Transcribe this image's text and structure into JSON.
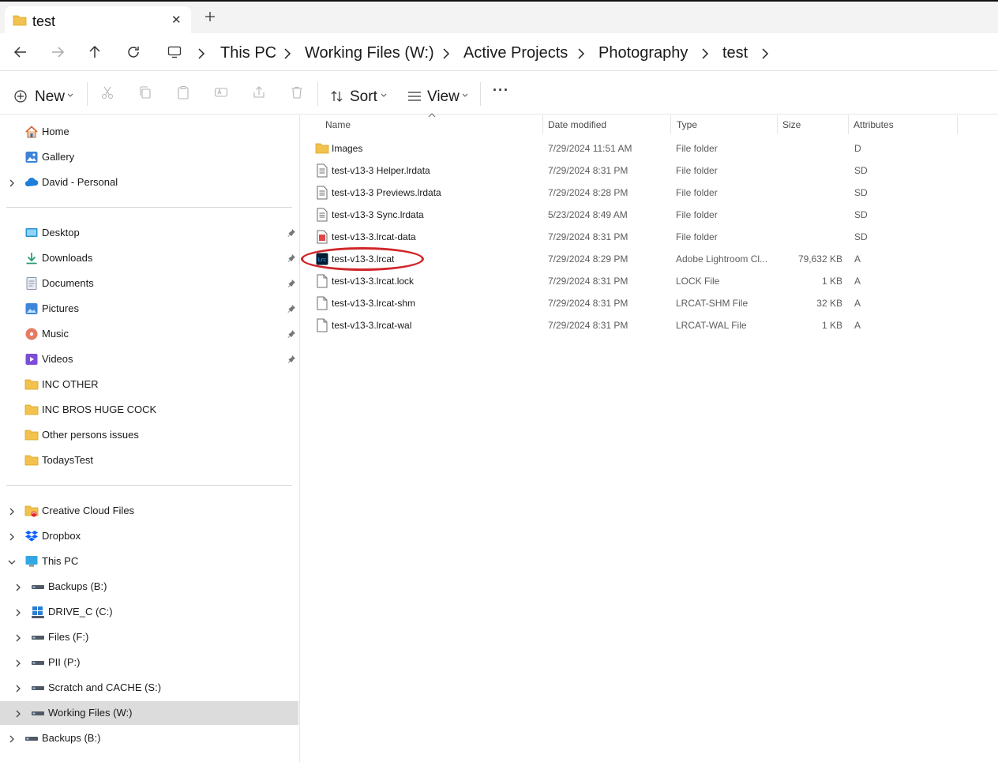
{
  "tab": {
    "title": "test",
    "close_glyph": "✕",
    "new_glyph": "+"
  },
  "breadcrumb": [
    "This PC",
    "Working Files (W:)",
    "Active Projects",
    "Photography",
    "test"
  ],
  "toolbar": {
    "new_label": "New",
    "sort_label": "Sort",
    "view_label": "View",
    "more_glyph": "···"
  },
  "sidebar": {
    "quick": [
      {
        "label": "Home",
        "icon": "home-icon",
        "expandable": false
      },
      {
        "label": "Gallery",
        "icon": "gallery-icon",
        "expandable": false
      },
      {
        "label": "David - Personal",
        "icon": "onedrive-icon",
        "expandable": true
      }
    ],
    "pinned": [
      {
        "label": "Desktop",
        "icon": "desktop-icon",
        "pinned": true
      },
      {
        "label": "Downloads",
        "icon": "downloads-icon",
        "pinned": true
      },
      {
        "label": "Documents",
        "icon": "documents-icon",
        "pinned": true
      },
      {
        "label": "Pictures",
        "icon": "pictures-icon",
        "pinned": true
      },
      {
        "label": "Music",
        "icon": "music-icon",
        "pinned": true
      },
      {
        "label": "Videos",
        "icon": "videos-icon",
        "pinned": true
      },
      {
        "label": "INC OTHER",
        "icon": "folder-icon",
        "pinned": false
      },
      {
        "label": "INC BROS HUGE COCK",
        "icon": "folder-icon",
        "pinned": false
      },
      {
        "label": "Other persons issues",
        "icon": "folder-icon",
        "pinned": false
      },
      {
        "label": "TodaysTest",
        "icon": "folder-icon",
        "pinned": false
      }
    ],
    "locations": [
      {
        "label": "Creative Cloud Files",
        "icon": "creative-cloud-icon",
        "level": 0,
        "expand": "collapsed"
      },
      {
        "label": "Dropbox",
        "icon": "dropbox-icon",
        "level": 0,
        "expand": "collapsed"
      },
      {
        "label": "This PC",
        "icon": "this-pc-icon",
        "level": 0,
        "expand": "expanded"
      },
      {
        "label": "Backups (B:)",
        "icon": "drive-icon",
        "level": 1,
        "expand": "collapsed"
      },
      {
        "label": "DRIVE_C (C:)",
        "icon": "windows-drive-icon",
        "level": 1,
        "expand": "collapsed"
      },
      {
        "label": "Files (F:)",
        "icon": "drive-icon",
        "level": 1,
        "expand": "collapsed"
      },
      {
        "label": "PII (P:)",
        "icon": "drive-icon",
        "level": 1,
        "expand": "collapsed"
      },
      {
        "label": "Scratch and CACHE (S:)",
        "icon": "drive-icon",
        "level": 1,
        "expand": "collapsed"
      },
      {
        "label": "Working Files (W:)",
        "icon": "drive-icon",
        "level": 1,
        "expand": "collapsed",
        "selected": true
      },
      {
        "label": "Backups (B:)",
        "icon": "drive-icon",
        "level": 0,
        "expand": "collapsed"
      }
    ]
  },
  "columns": {
    "name": "Name",
    "date": "Date modified",
    "type": "Type",
    "size": "Size",
    "attributes": "Attributes"
  },
  "files": [
    {
      "name": "Images",
      "date": "7/29/2024 11:51 AM",
      "type": "File folder",
      "size": "",
      "attr": "D",
      "icon": "folder-icon"
    },
    {
      "name": "test-v13-3 Helper.lrdata",
      "date": "7/29/2024 8:31 PM",
      "type": "File folder",
      "size": "",
      "attr": "SD",
      "icon": "lrdata-icon"
    },
    {
      "name": "test-v13-3 Previews.lrdata",
      "date": "7/29/2024 8:28 PM",
      "type": "File folder",
      "size": "",
      "attr": "SD",
      "icon": "lrdata-icon"
    },
    {
      "name": "test-v13-3 Sync.lrdata",
      "date": "5/23/2024 8:49 AM",
      "type": "File folder",
      "size": "",
      "attr": "SD",
      "icon": "lrdata-icon"
    },
    {
      "name": "test-v13-3.lrcat-data",
      "date": "7/29/2024 8:31 PM",
      "type": "File folder",
      "size": "",
      "attr": "SD",
      "icon": "lrcat-data-icon"
    },
    {
      "name": "test-v13-3.lrcat",
      "date": "7/29/2024 8:29 PM",
      "type": "Adobe Lightroom Cl...",
      "size": "79,632 KB",
      "attr": "A",
      "icon": "lightroom-icon",
      "highlighted": true
    },
    {
      "name": "test-v13-3.lrcat.lock",
      "date": "7/29/2024 8:31 PM",
      "type": "LOCK File",
      "size": "1 KB",
      "attr": "A",
      "icon": "blank-file-icon"
    },
    {
      "name": "test-v13-3.lrcat-shm",
      "date": "7/29/2024 8:31 PM",
      "type": "LRCAT-SHM File",
      "size": "32 KB",
      "attr": "A",
      "icon": "blank-file-icon"
    },
    {
      "name": "test-v13-3.lrcat-wal",
      "date": "7/29/2024 8:31 PM",
      "type": "LRCAT-WAL File",
      "size": "1 KB",
      "attr": "A",
      "icon": "blank-file-icon"
    }
  ],
  "colors": {
    "accent": "#0067c0",
    "folder": "#f2c14e",
    "selection": "#dcdcdc",
    "highlight_ring": "#d0262a"
  }
}
